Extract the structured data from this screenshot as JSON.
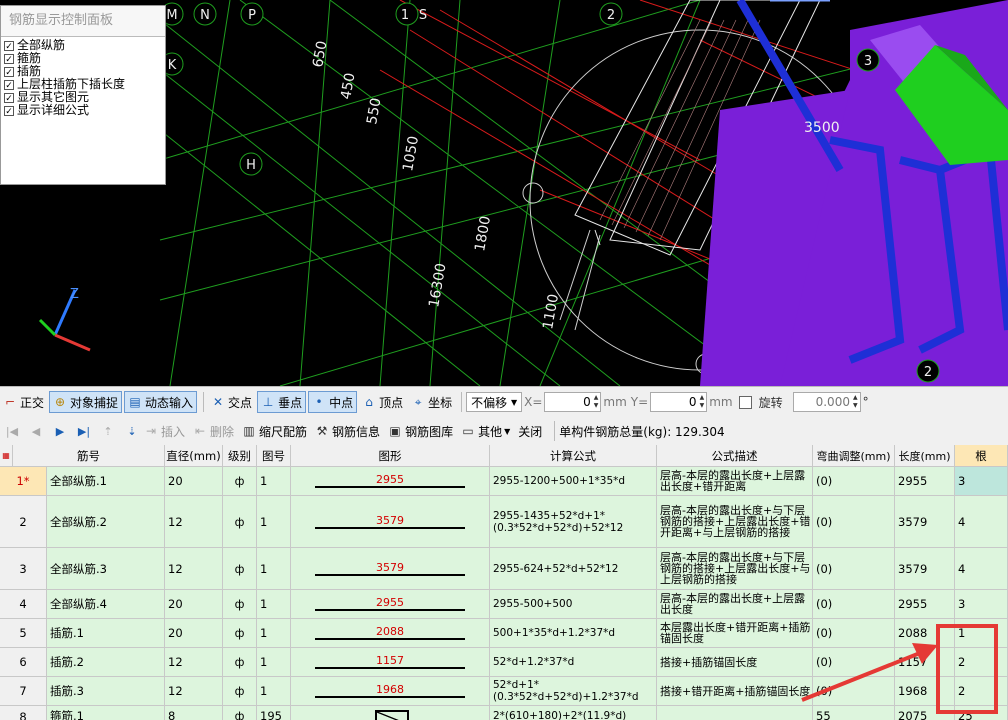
{
  "control_panel": {
    "title": "钢筋显示控制面板",
    "items": [
      {
        "label": "全部纵筋",
        "checked": true
      },
      {
        "label": "箍筋",
        "checked": true
      },
      {
        "label": "插筋",
        "checked": true
      },
      {
        "label": "上层柱插筋下插长度",
        "checked": true
      },
      {
        "label": "显示其它图元",
        "checked": true
      },
      {
        "label": "显示详细公式",
        "checked": true
      }
    ]
  },
  "viewport": {
    "axis_labels": [
      "M",
      "N",
      "P",
      "1",
      "S",
      "2",
      "H",
      "3",
      "2",
      "K"
    ],
    "dimensions": [
      "650",
      "450",
      "550",
      "1050",
      "1800",
      "16300",
      "1100",
      "3500"
    ],
    "axis_gizmo": {
      "z": "Z"
    },
    "colors": {
      "grid": "#1f9e1f",
      "red_line": "#d81b1b",
      "purple": "#7a1fd8",
      "blue": "#1e2fd6",
      "green": "#1fcf1f"
    }
  },
  "toolbar1": {
    "ortho": "正交",
    "snap": "对象捕捉",
    "dynamic_input": "动态输入",
    "intersection": "交点",
    "perpendicular": "垂点",
    "midpoint": "中点",
    "vertex": "顶点",
    "coordinate": "坐标",
    "offset_mode": "不偏移",
    "x_label": "X=",
    "x_value": "0",
    "y_label": "Y=",
    "y_value": "0",
    "unit": "mm",
    "rotate": "旋转",
    "rotate_value": "0.000",
    "degree": "°"
  },
  "toolbar2": {
    "insert": "插入",
    "delete": "删除",
    "scale_rebar": "缩尺配筋",
    "rebar_info": "钢筋信息",
    "rebar_library": "钢筋图库",
    "other": "其他",
    "close": "关闭",
    "total_weight": "单构件钢筋总量(kg): 129.304"
  },
  "grid": {
    "headers": [
      "筋号",
      "直径(mm)",
      "级别",
      "图号",
      "图形",
      "计算公式",
      "公式描述",
      "弯曲调整(mm)",
      "长度(mm)",
      "根"
    ],
    "rows": [
      {
        "idx": "1*",
        "name": "全部纵筋.1",
        "dia": "20",
        "grade": "ф",
        "fig": "1",
        "shape": "2955",
        "formula": "2955-1200+500+1*35*d",
        "desc": "层高-本层的露出长度+上层露出长度+错开距离",
        "bend": "(0)",
        "len": "2955",
        "count": "3"
      },
      {
        "idx": "2",
        "name": "全部纵筋.2",
        "dia": "12",
        "grade": "ф",
        "fig": "1",
        "shape": "3579",
        "formula": "2955-1435+52*d+1*(0.3*52*d+52*d)+52*12",
        "desc": "层高-本层的露出长度+与下层钢筋的搭接+上层露出长度+错开距离+与上层钢筋的搭接",
        "bend": "(0)",
        "len": "3579",
        "count": "4"
      },
      {
        "idx": "3",
        "name": "全部纵筋.3",
        "dia": "12",
        "grade": "ф",
        "fig": "1",
        "shape": "3579",
        "formula": "2955-624+52*d+52*12",
        "desc": "层高-本层的露出长度+与下层钢筋的搭接+上层露出长度+与上层钢筋的搭接",
        "bend": "(0)",
        "len": "3579",
        "count": "4"
      },
      {
        "idx": "4",
        "name": "全部纵筋.4",
        "dia": "20",
        "grade": "ф",
        "fig": "1",
        "shape": "2955",
        "formula": "2955-500+500",
        "desc": "层高-本层的露出长度+上层露出长度",
        "bend": "(0)",
        "len": "2955",
        "count": "3"
      },
      {
        "idx": "5",
        "name": "插筋.1",
        "dia": "20",
        "grade": "ф",
        "fig": "1",
        "shape": "2088",
        "formula": "500+1*35*d+1.2*37*d",
        "desc": "本层露出长度+错开距离+插筋锚固长度",
        "bend": "(0)",
        "len": "2088",
        "count": "1"
      },
      {
        "idx": "6",
        "name": "插筋.2",
        "dia": "12",
        "grade": "ф",
        "fig": "1",
        "shape": "1157",
        "formula": "52*d+1.2*37*d",
        "desc": "搭接+插筋锚固长度",
        "bend": "(0)",
        "len": "1157",
        "count": "2"
      },
      {
        "idx": "7",
        "name": "插筋.3",
        "dia": "12",
        "grade": "ф",
        "fig": "1",
        "shape": "1968",
        "formula": "52*d+1*(0.3*52*d+52*d)+1.2*37*d",
        "desc": "搭接+错开距离+插筋锚固长度",
        "bend": "(0)",
        "len": "1968",
        "count": "2"
      },
      {
        "idx": "8",
        "name": "箍筋.1",
        "dia": "8",
        "grade": "ф",
        "fig": "195",
        "shape": "",
        "formula": "2*(610+180)+2*(11.9*d)",
        "desc": "",
        "bend": "55",
        "len": "2075",
        "count": "25"
      }
    ]
  }
}
